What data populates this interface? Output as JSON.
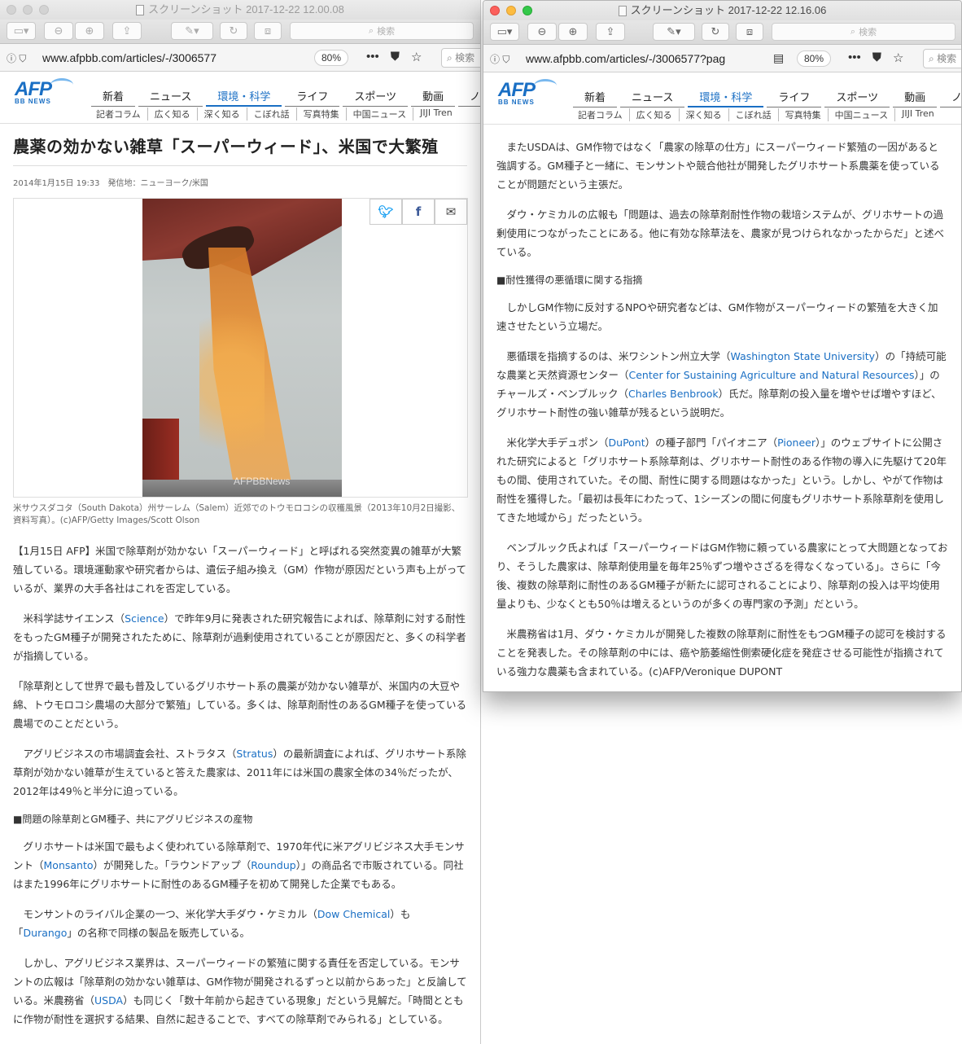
{
  "left_window": {
    "title": "スクリーンショット 2017-12-22 12.00.08",
    "search_placeholder": "検索",
    "url": "www.afpbb.com/articles/-/3006577",
    "zoom": "80%",
    "url_search": "検索"
  },
  "right_window": {
    "title": "スクリーンショット 2017-12-22 12.16.06",
    "search_placeholder": "検索",
    "url": "www.afpbb.com/articles/-/3006577?pag",
    "zoom": "80%",
    "url_search": "検索"
  },
  "site": {
    "logo": "AFP",
    "logo_sub": "BB NEWS",
    "nav": [
      "新着",
      "ニュース",
      "環境・科学",
      "ライフ",
      "スポーツ",
      "動画",
      "ノ"
    ],
    "subnav": [
      "記者コラム",
      "広く知る",
      "深く知る",
      "こぼれ話",
      "写真特集",
      "中国ニュース",
      "JIJI Tren"
    ]
  },
  "share_icons": [
    "twitter-icon",
    "facebook-icon",
    "mail-icon"
  ],
  "article": {
    "headline": "農薬の効かない雑草「スーパーウィード」、米国で大繁殖",
    "dateline": "2014年1月15日 19:33　発信地：ニューヨーク/米国",
    "watermark": "AFPBBNews",
    "caption": "米サウスダコタ（South Dakota）州サーレム（Salem）近郊でのトウモロコシの収穫風景（2013年10月2日撮影、資料写真）。(c)AFP/Getty Images/Scott Olson",
    "p1": "【1月15日 AFP】米国で除草剤が効かない「スーパーウィード」と呼ばれる突然変異の雑草が大繁殖している。環境運動家や研究者からは、遺伝子組み換え（GM）作物が原因だという声も上がっているが、業界の大手各社はこれを否定している。",
    "p2a": "　米科学誌サイエンス（",
    "p2link": "Science",
    "p2b": "）で昨年9月に発表された研究報告によれば、除草剤に対する耐性をもったGM種子が開発されたために、除草剤が過剰使用されていることが原因だと、多くの科学者が指摘している。",
    "p3": "「除草剤として世界で最も普及しているグリホサート系の農薬が効かない雑草が、米国内の大豆や綿、トウモロコシ農場の大部分で繁殖」している。多くは、除草剤耐性のあるGM種子を使っている農場でのことだという。",
    "p4a": "　アグリビジネスの市場調査会社、ストラタス（",
    "p4link": "Stratus",
    "p4b": "）の最新調査によれば、グリホサート系除草剤が効かない雑草が生えていると答えた農家は、2011年には米国の農家全体の34％だったが、2012年は49％と半分に迫っている。",
    "h1": "■問題の除草剤とGM種子、共にアグリビジネスの産物",
    "p5a": "　グリホサートは米国で最もよく使われている除草剤で、1970年代に米アグリビジネス大手モンサント（",
    "p5link1": "Monsanto",
    "p5b": "）が開発した。「ラウンドアップ（",
    "p5link2": "Roundup",
    "p5c": "）」の商品名で市販されている。同社はまた1996年にグリホサートに耐性のあるGM種子を初めて開発した企業でもある。",
    "p6a": "　モンサントのライバル企業の一つ、米化学大手ダウ・ケミカル（",
    "p6link1": "Dow Chemical",
    "p6b": "）も「",
    "p6link2": "Durango",
    "p6c": "」の名称で同様の製品を販売している。",
    "p7a": "　しかし、アグリビジネス業界は、スーパーウィードの繁殖に関する責任を否定している。モンサントの広報は「除草剤の効かない雑草は、GM作物が開発されるずっと以前からあった」と反論している。米農務省（",
    "p7link": "USDA",
    "p7b": "）も同じく「数十年前から起きている現象」だという見解だ。「時間とともに作物が耐性を選択する結果、自然に起きることで、すべての除草剤でみられる」としている。"
  },
  "article2": {
    "p1": "　またUSDAは、GM作物ではなく「農家の除草の仕方」にスーパーウィード繁殖の一因があると強調する。GM種子と一緒に、モンサントや競合他社が開発したグリホサート系農薬を使っていることが問題だという主張だ。",
    "p2": "　ダウ・ケミカルの広報も「問題は、過去の除草剤耐性作物の栽培システムが、グリホサートの過剰使用につながったことにある。他に有効な除草法を、農家が見つけられなかったからだ」と述べている。",
    "h1": "■耐性獲得の悪循環に関する指摘",
    "p3": "　しかしGM作物に反対するNPOや研究者などは、GM作物がスーパーウィードの繁殖を大きく加速させたという立場だ。",
    "p4a": "　悪循環を指摘するのは、米ワシントン州立大学（",
    "p4link1": "Washington State University",
    "p4b": "）の「持続可能な農業と天然資源センター（",
    "p4link2": "Center for Sustaining Agriculture and Natural Resources",
    "p4c": "）」のチャールズ・ベンブルック（",
    "p4link3": "Charles Benbrook",
    "p4d": "）氏だ。除草剤の投入量を増やせば増やすほど、グリホサート耐性の強い雑草が残るという説明だ。",
    "p5a": "　米化学大手デュポン（",
    "p5link1": "DuPont",
    "p5b": "）の種子部門「パイオニア（",
    "p5link2": "Pioneer",
    "p5c": "）」のウェブサイトに公開された研究によると「グリホサート系除草剤は、グリホサート耐性のある作物の導入に先駆けて20年もの間、使用されていた。その間、耐性に関する問題はなかった」という。しかし、やがて作物は耐性を獲得した。「最初は長年にわたって、1シーズンの間に何度もグリホサート系除草剤を使用してきた地域から」だったという。",
    "p6": "　ベンブルック氏よれば「スーパーウィードはGM作物に頼っている農家にとって大問題となっており、そうした農家は、除草剤使用量を毎年25％ずつ増やさざるを得なくなっている」。さらに「今後、複数の除草剤に耐性のあるGM種子が新たに認可されることにより、除草剤の投入は平均使用量よりも、少なくとも50％は増えるというのが多くの専門家の予測」だという。",
    "p7": "　米農務省は1月、ダウ・ケミカルが開発した複数の除草剤に耐性をもつGM種子の認可を検討することを発表した。その除草剤の中には、癌や筋萎縮性側索硬化症を発症させる可能性が指摘されている強力な農薬も含まれている。(c)AFP/Veronique DUPONT"
  }
}
